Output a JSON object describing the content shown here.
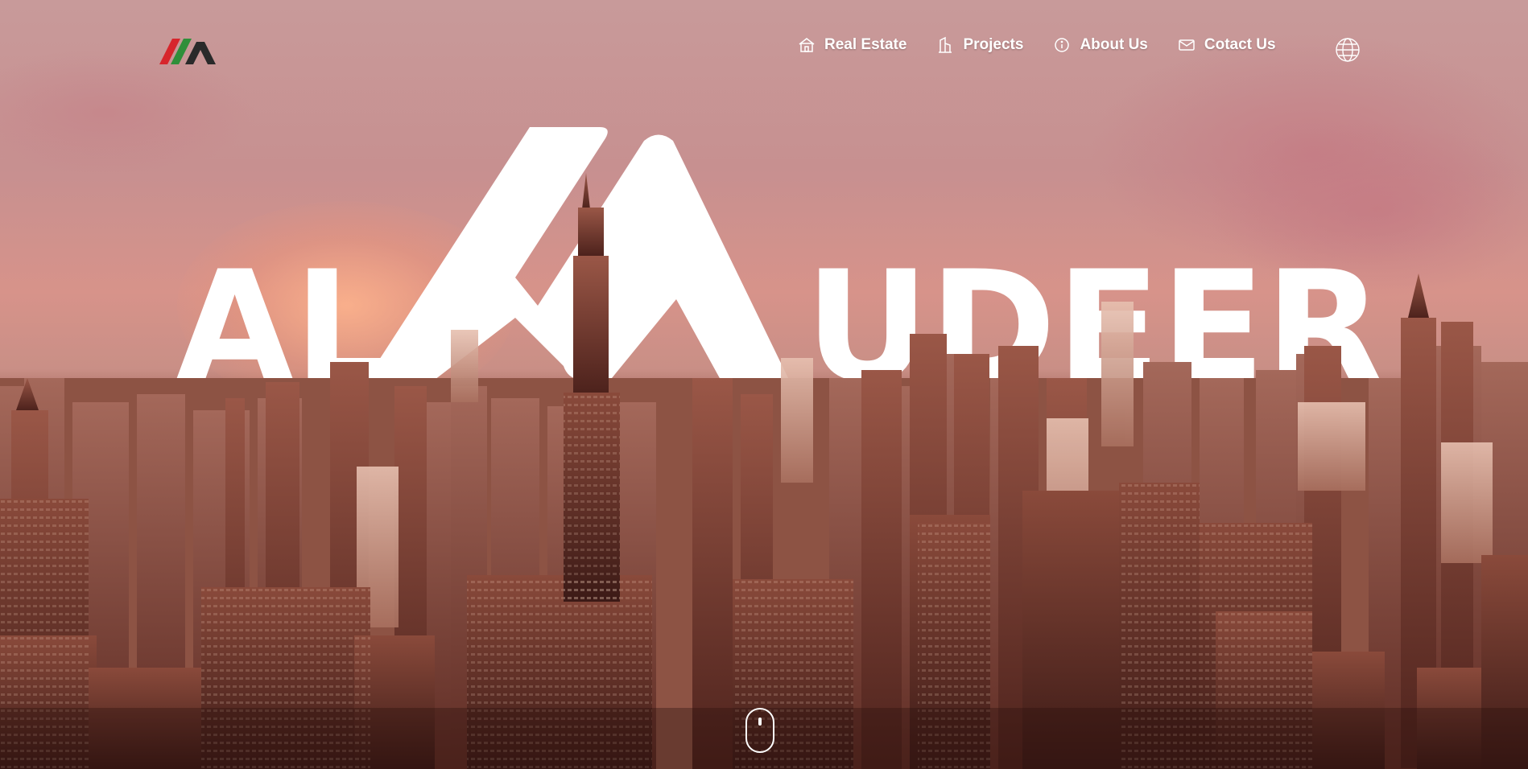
{
  "nav": {
    "items": [
      {
        "label": "Real Estate",
        "icon": "house-icon"
      },
      {
        "label": "Projects",
        "icon": "building-icon"
      },
      {
        "label": "About Us",
        "icon": "info-icon"
      },
      {
        "label": "Cotact Us",
        "icon": "mail-icon"
      }
    ],
    "language_icon": "globe-icon"
  },
  "hero": {
    "word_left": "AL",
    "word_right": "UDEER"
  },
  "brand": {
    "logo_colors": [
      "#d7262c",
      "#2f8f3a",
      "#2a2a2a"
    ]
  },
  "scroll_indicator": "mouse-icon"
}
